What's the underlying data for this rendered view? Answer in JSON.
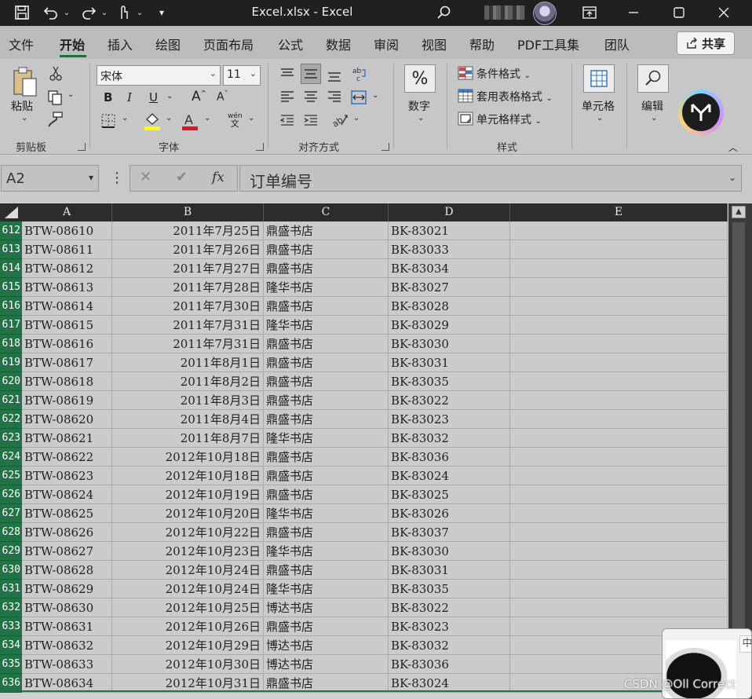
{
  "titlebar": {
    "title": "Excel.xlsx  -  Excel",
    "icons": [
      "save-icon",
      "undo-icon",
      "redo-icon",
      "touch-mode-icon",
      "customize-qat-icon",
      "search-icon",
      "ribbon-display-icon",
      "minimize-icon",
      "maximize-icon",
      "close-icon"
    ]
  },
  "tabs": {
    "items": [
      "文件",
      "开始",
      "插入",
      "绘图",
      "页面布局",
      "公式",
      "数据",
      "审阅",
      "视图",
      "帮助",
      "PDF工具集",
      "团队"
    ],
    "active": "开始",
    "share_label": "共享"
  },
  "ribbon": {
    "clipboard": {
      "paste_label": "粘贴",
      "group_label": "剪贴板"
    },
    "font": {
      "font_name": "宋体",
      "font_size": "11",
      "bold": "B",
      "italic": "I",
      "underline": "U",
      "grow": "A",
      "shrink": "A",
      "phonetic": "wén",
      "phonetic_sub": "文",
      "group_label": "字体",
      "highlight_color": "#ffff00",
      "font_color": "#e81123"
    },
    "alignment": {
      "group_label": "对齐方式"
    },
    "number": {
      "symbol": "%",
      "label": "数字"
    },
    "styles": {
      "conditional": "条件格式",
      "table": "套用表格格式",
      "cell_styles": "单元格样式",
      "group_label": "样式"
    },
    "cells": {
      "label": "单元格"
    },
    "editing": {
      "label": "编辑"
    }
  },
  "formula_bar": {
    "name_box": "A2",
    "cancel": "✕",
    "enter": "✔",
    "fx": "fx",
    "content": "订单编号"
  },
  "grid": {
    "columns": [
      "A",
      "B",
      "C",
      "D",
      "E"
    ],
    "rows": [
      {
        "num": "612",
        "a": "BTW-08610",
        "b": "2011年7月25日",
        "c": "鼎盛书店",
        "d": "BK-83021"
      },
      {
        "num": "613",
        "a": "BTW-08611",
        "b": "2011年7月26日",
        "c": "鼎盛书店",
        "d": "BK-83033"
      },
      {
        "num": "614",
        "a": "BTW-08612",
        "b": "2011年7月27日",
        "c": "鼎盛书店",
        "d": "BK-83034"
      },
      {
        "num": "615",
        "a": "BTW-08613",
        "b": "2011年7月28日",
        "c": "隆华书店",
        "d": "BK-83027"
      },
      {
        "num": "616",
        "a": "BTW-08614",
        "b": "2011年7月30日",
        "c": "鼎盛书店",
        "d": "BK-83028"
      },
      {
        "num": "617",
        "a": "BTW-08615",
        "b": "2011年7月31日",
        "c": "隆华书店",
        "d": "BK-83029"
      },
      {
        "num": "618",
        "a": "BTW-08616",
        "b": "2011年7月31日",
        "c": "鼎盛书店",
        "d": "BK-83030"
      },
      {
        "num": "619",
        "a": "BTW-08617",
        "b": "2011年8月1日",
        "c": "鼎盛书店",
        "d": "BK-83031"
      },
      {
        "num": "620",
        "a": "BTW-08618",
        "b": "2011年8月2日",
        "c": "鼎盛书店",
        "d": "BK-83035"
      },
      {
        "num": "621",
        "a": "BTW-08619",
        "b": "2011年8月3日",
        "c": "鼎盛书店",
        "d": "BK-83022"
      },
      {
        "num": "622",
        "a": "BTW-08620",
        "b": "2011年8月4日",
        "c": "鼎盛书店",
        "d": "BK-83023"
      },
      {
        "num": "623",
        "a": "BTW-08621",
        "b": "2011年8月7日",
        "c": "隆华书店",
        "d": "BK-83032"
      },
      {
        "num": "624",
        "a": "BTW-08622",
        "b": "2012年10月18日",
        "c": "鼎盛书店",
        "d": "BK-83036"
      },
      {
        "num": "625",
        "a": "BTW-08623",
        "b": "2012年10月18日",
        "c": "鼎盛书店",
        "d": "BK-83024"
      },
      {
        "num": "626",
        "a": "BTW-08624",
        "b": "2012年10月19日",
        "c": "鼎盛书店",
        "d": "BK-83025"
      },
      {
        "num": "627",
        "a": "BTW-08625",
        "b": "2012年10月20日",
        "c": "隆华书店",
        "d": "BK-83026"
      },
      {
        "num": "628",
        "a": "BTW-08626",
        "b": "2012年10月22日",
        "c": "鼎盛书店",
        "d": "BK-83037"
      },
      {
        "num": "629",
        "a": "BTW-08627",
        "b": "2012年10月23日",
        "c": "隆华书店",
        "d": "BK-83030"
      },
      {
        "num": "630",
        "a": "BTW-08628",
        "b": "2012年10月24日",
        "c": "鼎盛书店",
        "d": "BK-83031"
      },
      {
        "num": "631",
        "a": "BTW-08629",
        "b": "2012年10月24日",
        "c": "隆华书店",
        "d": "BK-83035"
      },
      {
        "num": "632",
        "a": "BTW-08630",
        "b": "2012年10月25日",
        "c": "博达书店",
        "d": "BK-83022"
      },
      {
        "num": "633",
        "a": "BTW-08631",
        "b": "2012年10月26日",
        "c": "鼎盛书店",
        "d": "BK-83023"
      },
      {
        "num": "634",
        "a": "BTW-08632",
        "b": "2012年10月29日",
        "c": "博达书店",
        "d": "BK-83032"
      },
      {
        "num": "635",
        "a": "BTW-08633",
        "b": "2012年10月30日",
        "c": "博达书店",
        "d": "BK-83036"
      },
      {
        "num": "636",
        "a": "BTW-08634",
        "b": "2012年10月31日",
        "c": "鼎盛书店",
        "d": "BK-83024"
      }
    ]
  },
  "overlay": {
    "button_label": "中"
  },
  "watermark": "CSDN @Oll Correct",
  "colors": {
    "accent": "#217346",
    "titlebar": "#202020"
  }
}
